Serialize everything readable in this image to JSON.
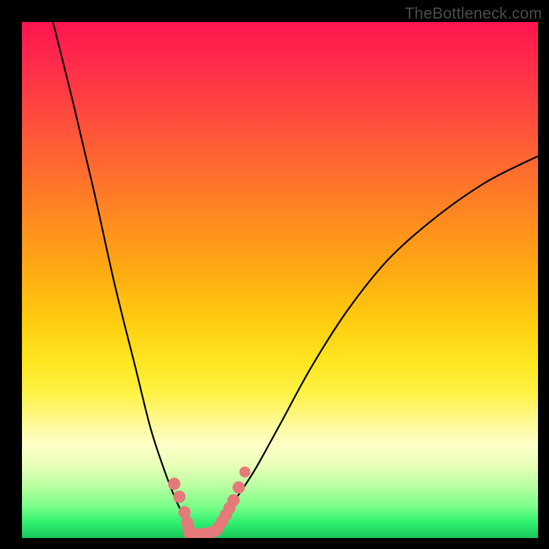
{
  "watermark": "TheBottleneck.com",
  "chart_data": {
    "type": "line",
    "title": "",
    "xlabel": "",
    "ylabel": "",
    "xlim": [
      0,
      100
    ],
    "ylim": [
      0,
      100
    ],
    "grid": false,
    "series": [
      {
        "name": "left-curve",
        "x": [
          6,
          10,
          14,
          18,
          22,
          25,
          28,
          30,
          32,
          33
        ],
        "y": [
          100,
          84,
          67,
          49,
          33,
          21,
          12,
          7,
          3,
          1
        ]
      },
      {
        "name": "right-curve",
        "x": [
          36,
          38,
          41,
          45,
          50,
          56,
          63,
          71,
          80,
          90,
          100
        ],
        "y": [
          1,
          3,
          7,
          13,
          22,
          33,
          44,
          54,
          62,
          69,
          74
        ]
      },
      {
        "name": "markers-left",
        "x": [
          29.5,
          30.5,
          31.5,
          32.0,
          32.3
        ],
        "y": [
          10.5,
          8.0,
          5.0,
          3.0,
          1.8
        ]
      },
      {
        "name": "markers-bottom",
        "x": [
          32.5,
          33.5,
          34.5,
          35.5,
          36.5,
          37.5
        ],
        "y": [
          0.9,
          0.7,
          0.7,
          0.8,
          1.0,
          1.4
        ]
      },
      {
        "name": "markers-right",
        "x": [
          38.0,
          38.8,
          39.5,
          40.2,
          41.0,
          42.0
        ],
        "y": [
          2.0,
          3.2,
          4.5,
          5.8,
          7.3,
          9.8
        ]
      },
      {
        "name": "marker-outlier",
        "x": [
          43.2
        ],
        "y": [
          12.8
        ]
      }
    ],
    "colors": {
      "curve": "#000000",
      "markers": "#e47a7a"
    },
    "annotations": []
  }
}
